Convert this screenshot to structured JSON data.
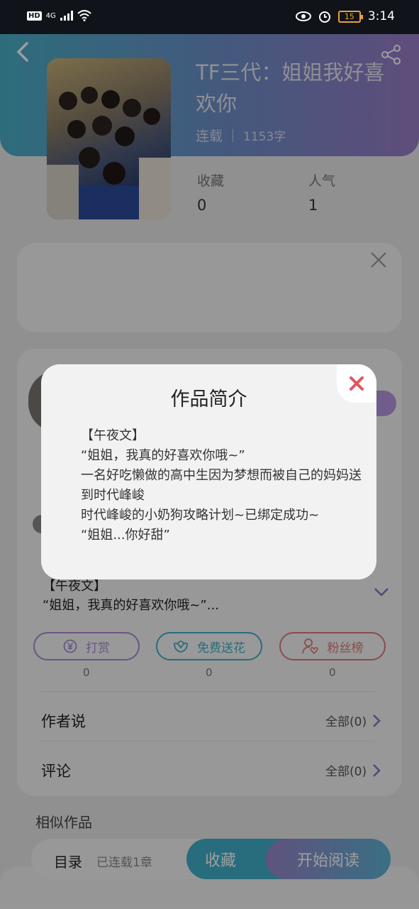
{
  "status_bar": {
    "network": "4G",
    "hd": "HD",
    "battery": "15",
    "time": "3:14"
  },
  "book": {
    "title": "TF三代：姐姐我好喜欢你",
    "status": "连载",
    "words": "1153字",
    "stats": [
      {
        "label": "收藏",
        "value": "0"
      },
      {
        "label": "人气",
        "value": "1"
      }
    ]
  },
  "synopsis_preview": {
    "line1": "【午夜文】",
    "line2": "“姐姐，我真的好喜欢你哦~”..."
  },
  "actions": [
    {
      "label": "打赏",
      "count": "0",
      "icon": "yen-coin-icon",
      "color": "#a88bd6"
    },
    {
      "label": "免费送花",
      "count": "0",
      "icon": "flower-icon",
      "color": "#3fb0ca"
    },
    {
      "label": "粉丝榜",
      "count": "0",
      "icon": "fan-heart-icon",
      "color": "#e07a7a"
    }
  ],
  "rows": [
    {
      "label": "作者说",
      "right": "全部(0)"
    },
    {
      "label": "评论",
      "right": "全部(0)"
    }
  ],
  "similar": {
    "heading": "相似作品"
  },
  "modal": {
    "title": "作品简介",
    "body": "【午夜文】\n“姐姐，我真的好喜欢你哦~”\n一名好吃懒做的高中生因为梦想而被自己的妈妈送到时代峰峻\n时代峰峻的小奶狗攻略计划~已绑定成功~\n“姐姐...你好甜”"
  },
  "bottom_bar": {
    "toc_label": "目录",
    "chapters": "已连载1章",
    "favorite_label": "收藏",
    "read_label": "开始阅读"
  },
  "colors": {
    "accent_teal": "#3fb0ca",
    "accent_purple": "#9a7dc8",
    "close_red": "#e05560"
  }
}
